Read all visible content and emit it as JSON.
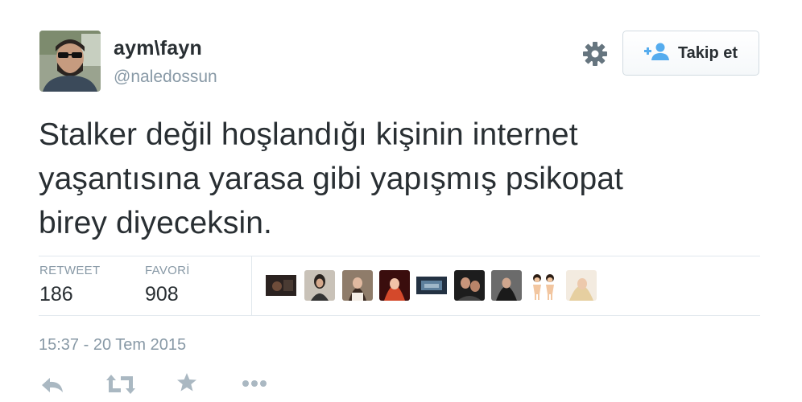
{
  "author": {
    "display_name": "aym\\fayn",
    "handle": "@naledossun"
  },
  "follow_button": {
    "label": "Takip et"
  },
  "tweet": {
    "lines": [
      "Stalker değil hoşlandığı kişinin internet",
      "yaşantısına yarasa gibi yapışmış psikopat",
      "birey diyeceksin."
    ]
  },
  "stats": {
    "retweet_label": "RETWEET",
    "retweet_count": "186",
    "favorite_label": "FAVORİ",
    "favorite_count": "908"
  },
  "timestamp": "15:37 - 20 Tem 2015",
  "colors": {
    "accent": "#55acee",
    "text": "#292f33",
    "secondary": "#8899a6",
    "border": "#e1e8ed"
  },
  "icons": {
    "settings": "gear-icon",
    "follow": "person-add-icon",
    "reply": "reply-icon",
    "retweet": "retweet-icon",
    "favorite": "star-icon",
    "more": "more-icon"
  }
}
